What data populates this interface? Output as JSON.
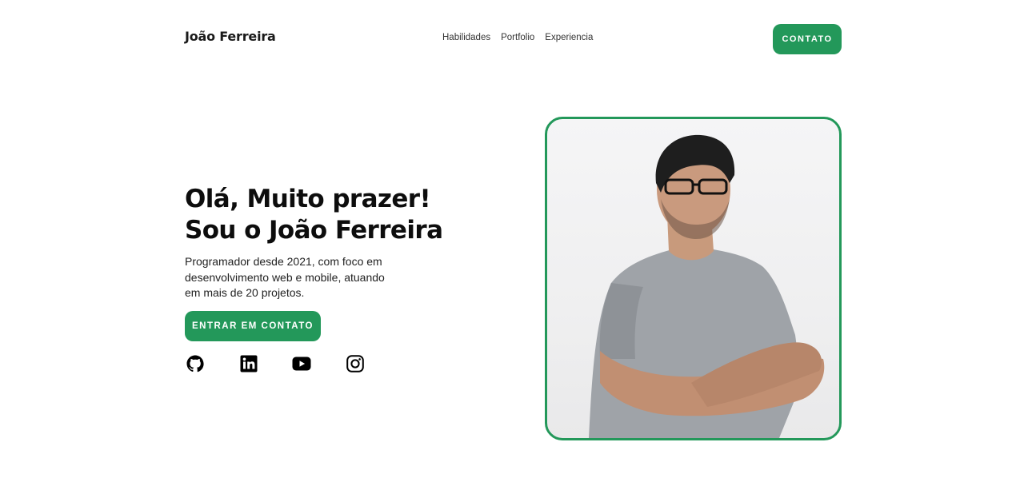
{
  "header": {
    "brand": "João Ferreira",
    "nav": [
      "Habilidades",
      "Portfolio",
      "Experiencia"
    ],
    "contact_button": "CONTATO"
  },
  "hero": {
    "headline_line1": "Olá, Muito prazer!",
    "headline_line2": "Sou o João Ferreira",
    "subtitle": "Programador desde 2021, com foco em desenvolvimento web e mobile, atuando em mais de 20 projetos.",
    "cta_button": "ENTRAR EM CONTATO",
    "socials": [
      "github-icon",
      "linkedin-icon",
      "youtube-icon",
      "instagram-icon"
    ]
  },
  "colors": {
    "accent": "#23985a",
    "text": "#111111",
    "background": "#ffffff"
  }
}
